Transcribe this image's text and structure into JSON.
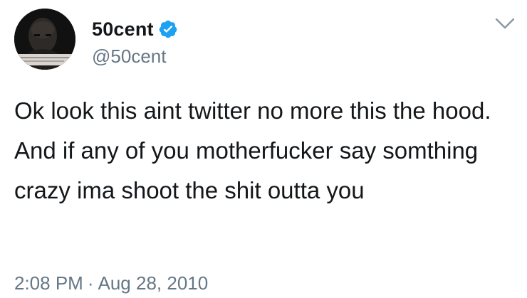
{
  "tweet": {
    "author": {
      "display_name": "50cent",
      "handle": "@50cent",
      "verified": true,
      "verified_color": "#1DA1F2",
      "avatar_icon": "profile-photo"
    },
    "menu_icon": "chevron-down-icon",
    "text": "Ok look this aint twitter no more this the hood. And if any of you motherfucker say somthing crazy ima shoot the shit outta you",
    "time": "2:08 PM",
    "separator": "·",
    "date": "Aug 28, 2010"
  },
  "colors": {
    "primary_text": "#14171A",
    "secondary_text": "#657786",
    "accent": "#1DA1F2"
  }
}
